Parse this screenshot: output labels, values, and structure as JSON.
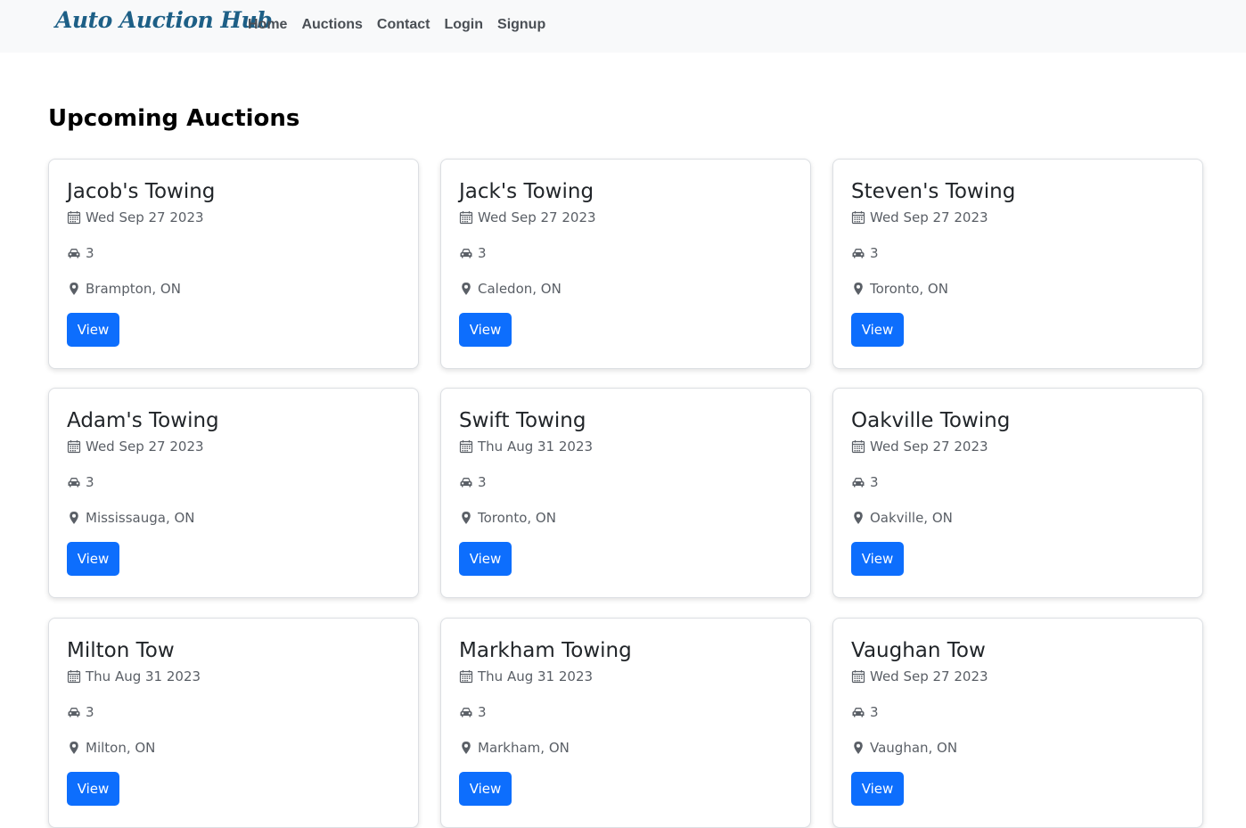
{
  "brand": "Auto Auction Hub",
  "nav": [
    "Home",
    "Auctions",
    "Contact",
    "Login",
    "Signup"
  ],
  "page_title": "Upcoming Auctions",
  "view_label": "View",
  "icons": {
    "date": "calendar-icon",
    "count": "car-icon",
    "location": "map-pin-icon"
  },
  "colors": {
    "primary": "#0d6efd",
    "brand": "#1d5f86",
    "navbar_bg": "#f8f9fa"
  },
  "auctions": [
    {
      "name": "Jacob's Towing",
      "date": "Wed Sep 27 2023",
      "count": "3",
      "location": "Brampton, ON"
    },
    {
      "name": "Jack's Towing",
      "date": "Wed Sep 27 2023",
      "count": "3",
      "location": "Caledon, ON"
    },
    {
      "name": "Steven's Towing",
      "date": "Wed Sep 27 2023",
      "count": "3",
      "location": "Toronto, ON"
    },
    {
      "name": "Adam's Towing",
      "date": "Wed Sep 27 2023",
      "count": "3",
      "location": "Mississauga, ON"
    },
    {
      "name": "Swift Towing",
      "date": "Thu Aug 31 2023",
      "count": "3",
      "location": "Toronto, ON"
    },
    {
      "name": "Oakville Towing",
      "date": "Wed Sep 27 2023",
      "count": "3",
      "location": "Oakville, ON"
    },
    {
      "name": "Milton Tow",
      "date": "Thu Aug 31 2023",
      "count": "3",
      "location": "Milton, ON"
    },
    {
      "name": "Markham Towing",
      "date": "Thu Aug 31 2023",
      "count": "3",
      "location": "Markham, ON"
    },
    {
      "name": "Vaughan Tow",
      "date": "Wed Sep 27 2023",
      "count": "3",
      "location": "Vaughan, ON"
    }
  ]
}
